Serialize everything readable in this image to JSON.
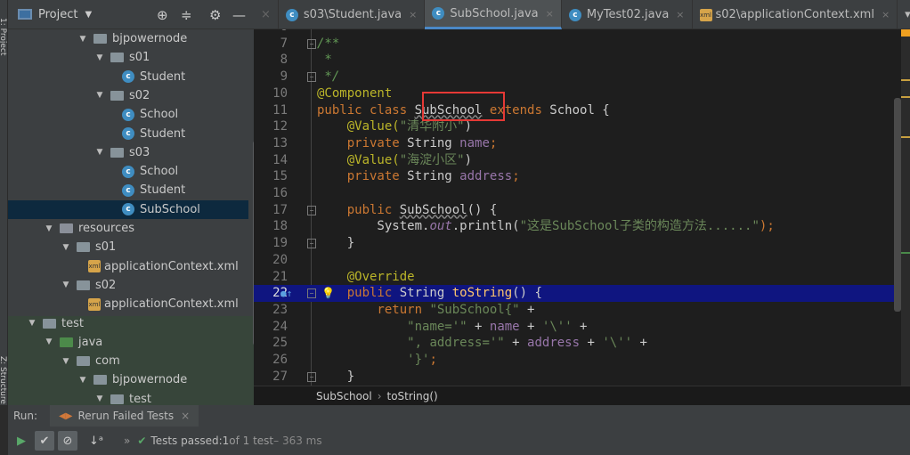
{
  "left_strip": {
    "project_label": "1: Project",
    "structure_label": "Z: Structure"
  },
  "project_panel": {
    "title": "Project"
  },
  "tree": [
    {
      "label": "bjpowernode",
      "depth": 4,
      "type": "folder",
      "arrow": "▼"
    },
    {
      "label": "s01",
      "depth": 5,
      "type": "folder",
      "arrow": "▼"
    },
    {
      "label": "Student",
      "depth": 6,
      "type": "class",
      "arrow": ""
    },
    {
      "label": "s02",
      "depth": 5,
      "type": "folder",
      "arrow": "▼"
    },
    {
      "label": "School",
      "depth": 6,
      "type": "class",
      "arrow": ""
    },
    {
      "label": "Student",
      "depth": 6,
      "type": "class",
      "arrow": ""
    },
    {
      "label": "s03",
      "depth": 5,
      "type": "folder",
      "arrow": "▼"
    },
    {
      "label": "School",
      "depth": 6,
      "type": "class",
      "arrow": ""
    },
    {
      "label": "Student",
      "depth": 6,
      "type": "class",
      "arrow": ""
    },
    {
      "label": "SubSchool",
      "depth": 6,
      "type": "class",
      "arrow": "",
      "selected": true
    },
    {
      "label": "resources",
      "depth": 2,
      "type": "res",
      "arrow": "▼"
    },
    {
      "label": "s01",
      "depth": 3,
      "type": "folder",
      "arrow": "▼"
    },
    {
      "label": "applicationContext.xml",
      "depth": 4,
      "type": "xml",
      "arrow": ""
    },
    {
      "label": "s02",
      "depth": 3,
      "type": "folder",
      "arrow": "▼"
    },
    {
      "label": "applicationContext.xml",
      "depth": 4,
      "type": "xml",
      "arrow": ""
    },
    {
      "label": "test",
      "depth": 1,
      "type": "folder",
      "arrow": "▼"
    },
    {
      "label": "java",
      "depth": 2,
      "type": "java",
      "arrow": "▼"
    },
    {
      "label": "com",
      "depth": 3,
      "type": "folder",
      "arrow": "▼"
    },
    {
      "label": "bjpowernode",
      "depth": 4,
      "type": "folder",
      "arrow": "▼"
    },
    {
      "label": "test",
      "depth": 5,
      "type": "folder",
      "arrow": "▼"
    }
  ],
  "tabs": [
    {
      "label": "s03\\Student.java",
      "icon": "class-icon"
    },
    {
      "label": "SubSchool.java",
      "icon": "class-icon",
      "active": true
    },
    {
      "label": "MyTest02.java",
      "icon": "test-class-icon"
    },
    {
      "label": "s02\\applicationContext.xml",
      "icon": "xml-icon"
    }
  ],
  "editor": {
    "lines": [
      {
        "n": "6",
        "t": []
      },
      {
        "n": "7",
        "t": [
          [
            "/**",
            "cm"
          ]
        ]
      },
      {
        "n": "8",
        "t": [
          [
            " *",
            "cm"
          ]
        ]
      },
      {
        "n": "9",
        "t": [
          [
            " */",
            "cm"
          ]
        ]
      },
      {
        "n": "10",
        "t": [
          [
            "@Component",
            "ann"
          ]
        ]
      },
      {
        "n": "11",
        "t": [
          [
            "public class ",
            "kw"
          ],
          [
            "SubSchool",
            "wav"
          ],
          [
            " extends ",
            "kw"
          ],
          [
            "School {",
            ""
          ]
        ]
      },
      {
        "n": "12",
        "t": [
          [
            "    @Value(",
            "ann"
          ],
          [
            "\"清华附小\"",
            "str"
          ],
          [
            ")",
            ""
          ]
        ]
      },
      {
        "n": "13",
        "t": [
          [
            "    private ",
            "kw"
          ],
          [
            "String ",
            ""
          ],
          [
            "name",
            "fld"
          ],
          [
            ";",
            "kw"
          ]
        ]
      },
      {
        "n": "14",
        "t": [
          [
            "    @Value(",
            "ann"
          ],
          [
            "\"海淀小区\"",
            "str"
          ],
          [
            ")",
            ""
          ]
        ]
      },
      {
        "n": "15",
        "t": [
          [
            "    private ",
            "kw"
          ],
          [
            "String ",
            ""
          ],
          [
            "address",
            "fld"
          ],
          [
            ";",
            "kw"
          ]
        ]
      },
      {
        "n": "16",
        "t": []
      },
      {
        "n": "17",
        "t": [
          [
            "    public ",
            "kw"
          ],
          [
            "SubSchool",
            "wav"
          ],
          [
            "() {",
            ""
          ]
        ]
      },
      {
        "n": "18",
        "t": [
          [
            "        System.",
            ""
          ],
          [
            "out",
            "ital"
          ],
          [
            ".println(",
            ""
          ],
          [
            "\"这是SubSchool子类的构造方法......\"",
            "str"
          ],
          [
            ");",
            "kw"
          ]
        ]
      },
      {
        "n": "19",
        "t": [
          [
            "    }",
            ""
          ]
        ]
      },
      {
        "n": "20",
        "t": []
      },
      {
        "n": "21",
        "t": [
          [
            "    @Override",
            "ann"
          ]
        ]
      },
      {
        "n": "22",
        "t": [
          [
            "    public ",
            "kw"
          ],
          [
            "String ",
            ""
          ],
          [
            "toString",
            "mth"
          ],
          [
            "() {",
            ""
          ]
        ],
        "highlight": true
      },
      {
        "n": "23",
        "t": [
          [
            "        return ",
            "kw"
          ],
          [
            "\"SubSchool{\"",
            "str"
          ],
          [
            " +",
            ""
          ]
        ]
      },
      {
        "n": "24",
        "t": [
          [
            "            ",
            ""
          ],
          [
            "\"name='\"",
            "str"
          ],
          [
            " + ",
            ""
          ],
          [
            "name",
            "fld"
          ],
          [
            " + ",
            ""
          ],
          [
            "'\\''",
            "str"
          ],
          [
            " +",
            ""
          ]
        ]
      },
      {
        "n": "25",
        "t": [
          [
            "            ",
            ""
          ],
          [
            "\", address='\"",
            "str"
          ],
          [
            " + ",
            ""
          ],
          [
            "address",
            "fld"
          ],
          [
            " + ",
            ""
          ],
          [
            "'\\''",
            "str"
          ],
          [
            " +",
            ""
          ]
        ]
      },
      {
        "n": "26",
        "t": [
          [
            "            ",
            ""
          ],
          [
            "'}'",
            "str"
          ],
          [
            ";",
            "kw"
          ]
        ]
      },
      {
        "n": "27",
        "t": [
          [
            "    }",
            ""
          ]
        ]
      }
    ]
  },
  "breadcrumb": {
    "class": "SubSchool",
    "method": "toString()"
  },
  "run": {
    "label": "Run:",
    "tab": "Rerun Failed Tests"
  },
  "status": {
    "prefix": "Tests passed: ",
    "count": "1",
    "suffix": " of 1 test",
    "time": " – 363 ms"
  },
  "colors": {
    "accent": "#4a88c7",
    "selection": "#0d293e",
    "highlight_line": "#0f1580",
    "red_box": "#e53935",
    "pass": "#59a869"
  }
}
